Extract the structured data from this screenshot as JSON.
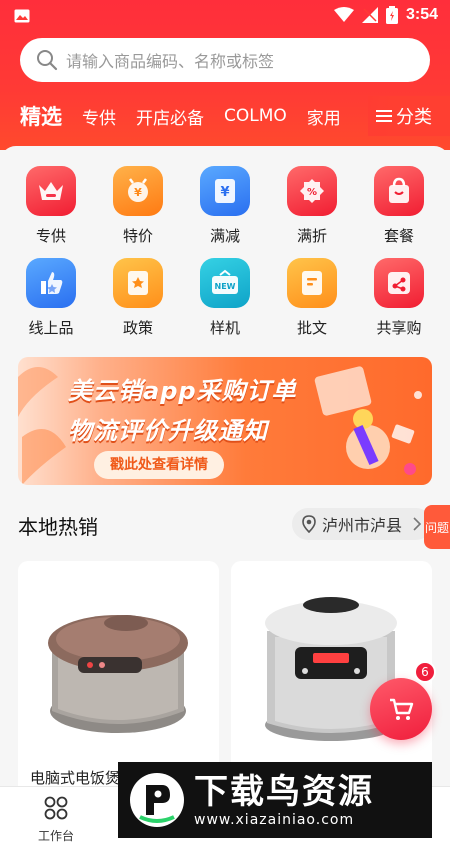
{
  "status_bar": {
    "time": "3:54"
  },
  "search": {
    "placeholder": "请输入商品编码、名称或标签"
  },
  "category_tabs": [
    "精选",
    "专供",
    "开店必备",
    "COLMO",
    "家用"
  ],
  "category_more": "分类",
  "shortcuts": [
    {
      "label": "专供",
      "icon": "crown-icon",
      "color": "red"
    },
    {
      "label": "特价",
      "icon": "price-tag-icon",
      "color": "orange"
    },
    {
      "label": "满减",
      "icon": "yen-coupon-icon",
      "color": "blue"
    },
    {
      "label": "满折",
      "icon": "percent-discount-icon",
      "color": "red"
    },
    {
      "label": "套餐",
      "icon": "shopping-bag-icon",
      "color": "red"
    },
    {
      "label": "线上品",
      "icon": "thumbs-up-icon",
      "color": "blue"
    },
    {
      "label": "政策",
      "icon": "star-document-icon",
      "color": "amber"
    },
    {
      "label": "样机",
      "icon": "new-tag-icon",
      "color": "teal"
    },
    {
      "label": "批文",
      "icon": "document-icon",
      "color": "amber"
    },
    {
      "label": "共享购",
      "icon": "share-icon",
      "color": "red"
    }
  ],
  "banner": {
    "line1": "美云销app采购订单",
    "line2": "物流评价升级通知",
    "cta": "戳此处查看详情"
  },
  "local_hot": {
    "title": "本地热销",
    "location": "泸州市泸县",
    "side_tab": "问题"
  },
  "products": [
    {
      "name": "电脑式电饭煲"
    },
    {
      "name": ""
    }
  ],
  "cart": {
    "badge": "6"
  },
  "bottom_nav": {
    "workbench_label": "工作台"
  },
  "watermark": {
    "brand": "下载鸟资源",
    "url": "www.xiazainiao.com"
  },
  "colors": {
    "header_red": "#ff3a35",
    "accent": "#f01e3c",
    "banner_orange": "#ff7b3a"
  }
}
